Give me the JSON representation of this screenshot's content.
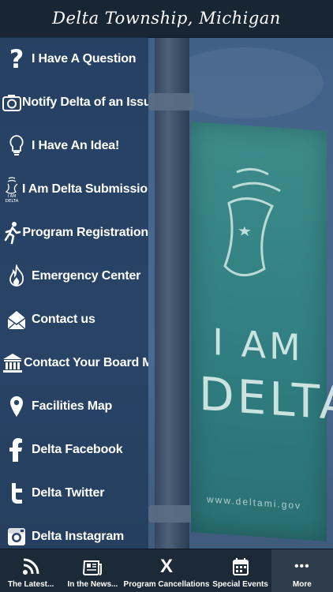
{
  "header": {
    "title": "Delta Township, Michigan"
  },
  "background": {
    "banner_word_1": "I AM",
    "banner_word_2": "DELTA",
    "banner_url": "www.deltami.gov"
  },
  "menu": {
    "items": [
      {
        "label": "I Have A Question",
        "icon": "question-icon"
      },
      {
        "label": "Notify Delta of an Issue",
        "icon": "camera-icon"
      },
      {
        "label": "I Have An Idea!",
        "icon": "lightbulb-icon"
      },
      {
        "label": "I Am Delta Submission",
        "icon": "i-am-delta-icon",
        "icon_text": "I AM DELTA"
      },
      {
        "label": "Program Registration",
        "icon": "runner-icon"
      },
      {
        "label": "Emergency Center",
        "icon": "flame-icon"
      },
      {
        "label": "Contact us",
        "icon": "envelope-icon"
      },
      {
        "label": "Contact Your Board Members",
        "icon": "government-building-icon"
      },
      {
        "label": "Facilities Map",
        "icon": "map-pin-icon"
      },
      {
        "label": "Delta Facebook",
        "icon": "facebook-icon"
      },
      {
        "label": "Delta Twitter",
        "icon": "twitter-icon"
      },
      {
        "label": "Delta Instagram",
        "icon": "instagram-icon"
      }
    ]
  },
  "tabbar": {
    "tabs": [
      {
        "label": "The Latest...",
        "icon": "rss-icon",
        "active": false
      },
      {
        "label": "In the News...",
        "icon": "newspaper-icon",
        "active": false
      },
      {
        "label": "Program Cancellations",
        "icon": "x-icon",
        "active": false,
        "icon_text": "X"
      },
      {
        "label": "Special Events",
        "icon": "calendar-icon",
        "active": false
      },
      {
        "label": "More",
        "icon": "more-dots-icon",
        "active": true,
        "icon_text": "•••"
      }
    ]
  },
  "colors": {
    "header_bg": "#182634",
    "menu_bg": "rgba(28,52,84,0.72)",
    "tabbar_bg": "#1c2a38",
    "active_tab_bg": "#2f3d4b",
    "text": "#ffffff"
  }
}
